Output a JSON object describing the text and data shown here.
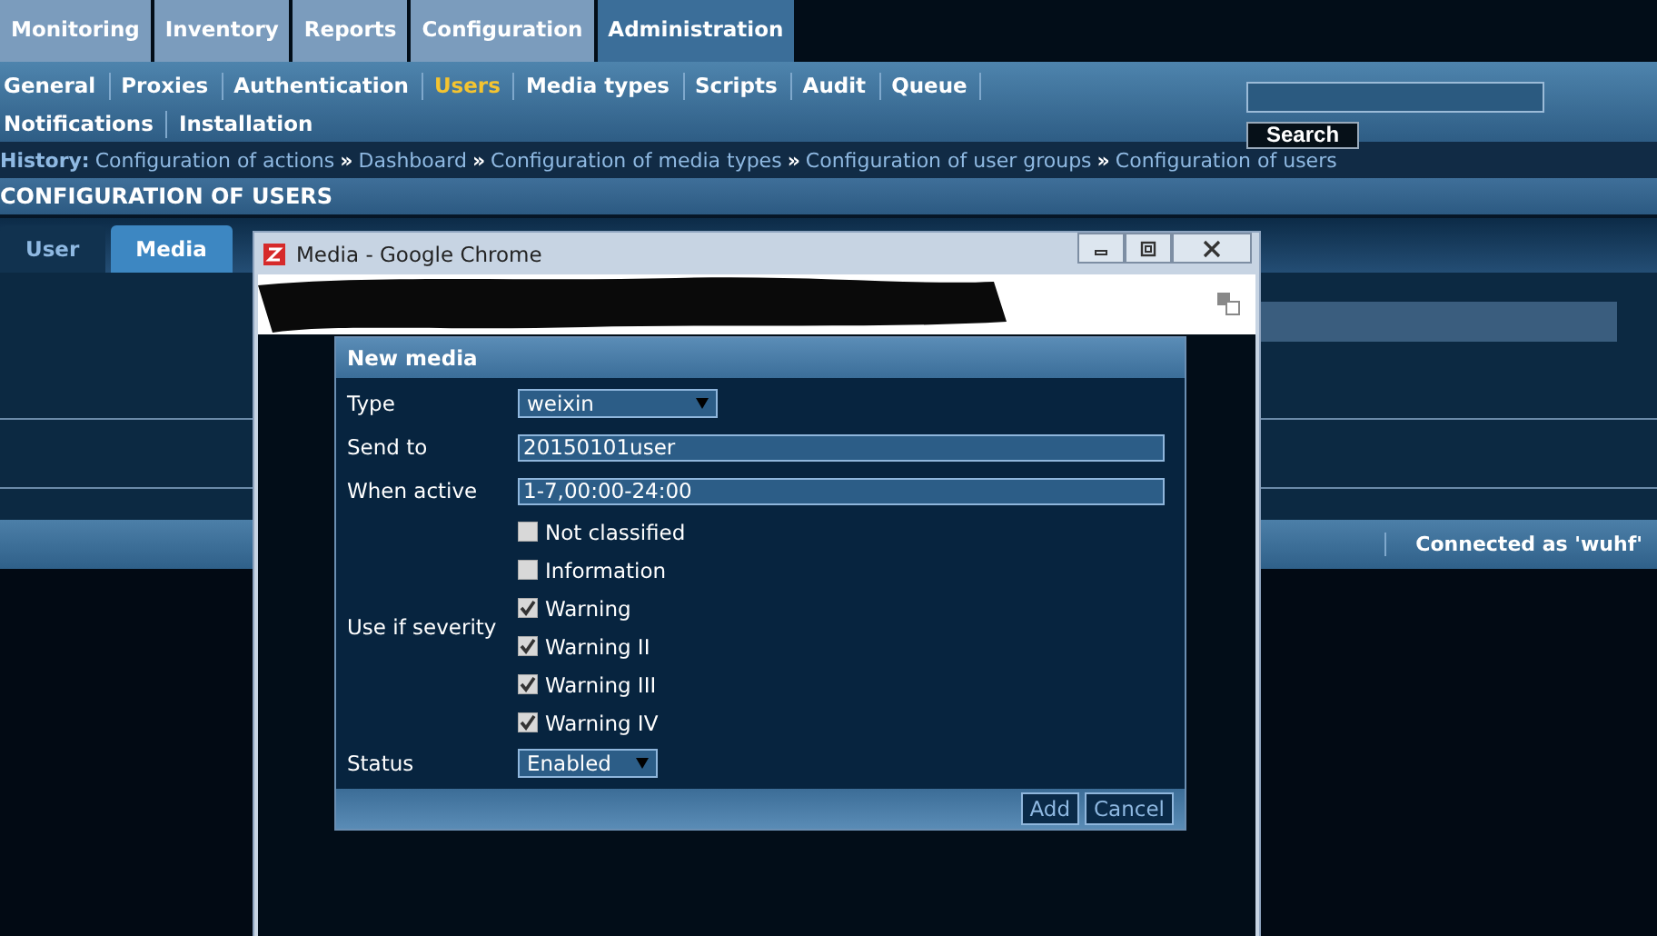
{
  "main_menu": [
    {
      "label": "Monitoring",
      "selected": false
    },
    {
      "label": "Inventory",
      "selected": false
    },
    {
      "label": "Reports",
      "selected": false
    },
    {
      "label": "Configuration",
      "selected": false
    },
    {
      "label": "Administration",
      "selected": true
    }
  ],
  "sub_menu": [
    {
      "label": "General",
      "selected": false
    },
    {
      "label": "Proxies",
      "selected": false
    },
    {
      "label": "Authentication",
      "selected": false
    },
    {
      "label": "Users",
      "selected": true
    },
    {
      "label": "Media types",
      "selected": false
    },
    {
      "label": "Scripts",
      "selected": false
    },
    {
      "label": "Audit",
      "selected": false
    },
    {
      "label": "Queue",
      "selected": false
    },
    {
      "label": "Notifications",
      "selected": false
    },
    {
      "label": "Installation",
      "selected": false
    }
  ],
  "search": {
    "button": "Search"
  },
  "history": {
    "label": "History:",
    "items": [
      "Configuration of actions",
      "Dashboard",
      "Configuration of media types",
      "Configuration of user groups",
      "Configuration of users"
    ],
    "separators": [
      "»",
      "»",
      "»",
      "»"
    ]
  },
  "page_title": "CONFIGURATION OF USERS",
  "tabs": [
    {
      "label": "User",
      "selected": false
    },
    {
      "label": "Media",
      "selected": true
    }
  ],
  "footer": {
    "connected": "Connected as 'wuhf'"
  },
  "popup": {
    "title": "Media - Google Chrome",
    "form": {
      "title": "New media",
      "fields": [
        {
          "kind": "select",
          "label": "Type",
          "value": "weixin"
        },
        {
          "kind": "text",
          "label": "Send to",
          "value": "20150101user"
        },
        {
          "kind": "text",
          "label": "When active",
          "value": "1-7,00:00-24:00"
        },
        {
          "kind": "checks",
          "label": "Use if severity",
          "options": [
            {
              "label": "Not classified",
              "checked": false
            },
            {
              "label": "Information",
              "checked": false
            },
            {
              "label": "Warning",
              "checked": true
            },
            {
              "label": "Warning II",
              "checked": true
            },
            {
              "label": "Warning III",
              "checked": true
            },
            {
              "label": "Warning IV",
              "checked": true
            }
          ]
        },
        {
          "kind": "select",
          "label": "Status",
          "value": "Enabled"
        }
      ],
      "buttons": [
        "Add",
        "Cancel"
      ]
    }
  }
}
